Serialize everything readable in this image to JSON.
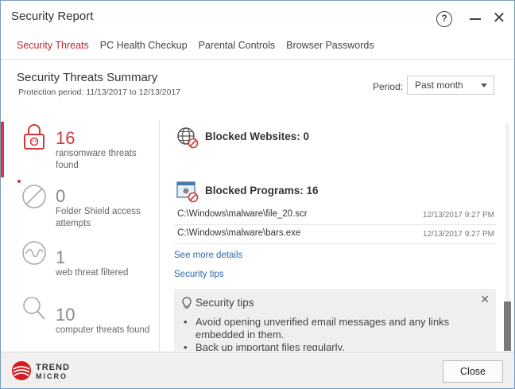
{
  "window": {
    "title": "Security Report"
  },
  "titlebar": {
    "help_glyph": "?",
    "close_glyph": "✕"
  },
  "tabs": [
    {
      "label": "Security Threats",
      "active": true
    },
    {
      "label": "PC Health Checkup",
      "active": false
    },
    {
      "label": "Parental Controls",
      "active": false
    },
    {
      "label": "Browser Passwords",
      "active": false
    }
  ],
  "summary": {
    "title": "Security Threats Summary",
    "protection_period": "Protection period: 11/13/2017 to 12/13/2017",
    "period_label": "Period:",
    "period_value": "Past month"
  },
  "stats": [
    {
      "value": "16",
      "label": "ransomware threats found",
      "icon": "lock-icon"
    },
    {
      "value": "0",
      "label": "Folder Shield access attempts",
      "icon": "no-entry-icon"
    },
    {
      "value": "1",
      "label": "web threat filtered",
      "icon": "wave-icon"
    },
    {
      "value": "10",
      "label": "computer threats found",
      "icon": "magnifier-icon"
    }
  ],
  "blocked_websites": {
    "title": "Blocked Websites: 0",
    "icon": "globe-blocked-icon"
  },
  "blocked_programs": {
    "title": "Blocked Programs: 16",
    "icon": "program-blocked-icon",
    "rows": [
      {
        "path": "C:\\Windows\\malware\\file_20.scr",
        "time": "12/13/2017 9:27 PM"
      },
      {
        "path": "C:\\Windows\\malware\\bars.exe",
        "time": "12/13/2017 9:27 PM"
      }
    ]
  },
  "links": {
    "see_more": "See more details",
    "security_tips": "Security tips"
  },
  "tips": {
    "title": "Security tips",
    "close_glyph": "✕",
    "bullet": "•",
    "items": [
      "Avoid opening unverified email messages and any links embedded in them.",
      "Back up important files regularly."
    ]
  },
  "footer": {
    "logo_word1": "TREND",
    "logo_word2": "MICRO",
    "close_label": "Close"
  },
  "colors": {
    "accent_red": "#c8202f",
    "link_blue": "#2d6ab1"
  }
}
